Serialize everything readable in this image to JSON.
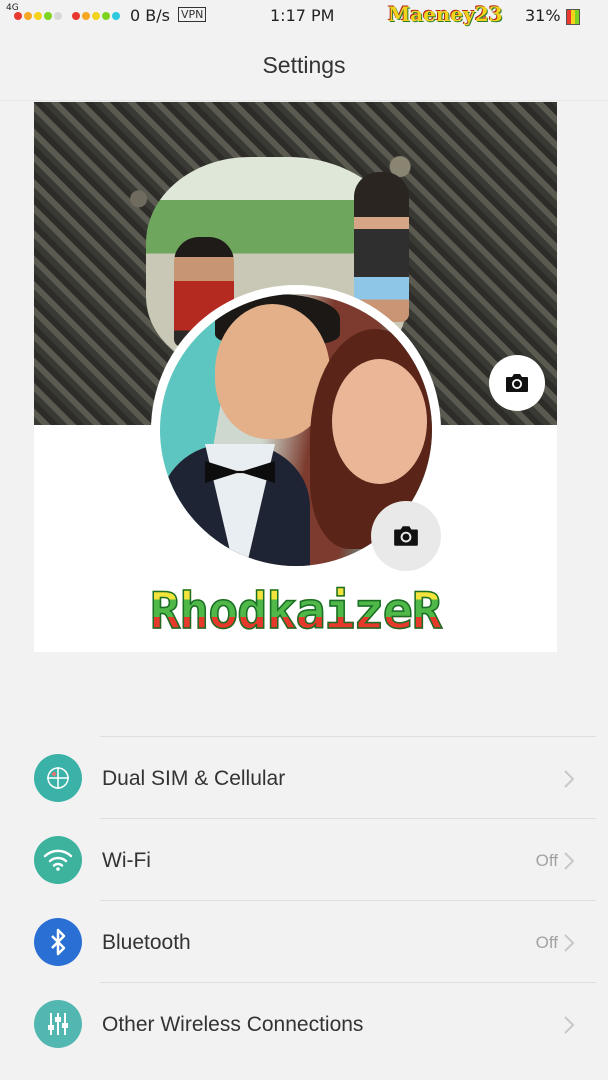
{
  "status_bar": {
    "network": "4G",
    "speed": "0 B/s",
    "vpn": "VPN",
    "time": "1:17 PM",
    "watermark": "Maeney23",
    "battery": "31%"
  },
  "nav": {
    "title": "Settings"
  },
  "profile": {
    "name": "RhodkaizeR"
  },
  "settings_items": [
    {
      "label": "Dual SIM & Cellular",
      "value": "",
      "icon": "sim-icon",
      "color": "#3bb2a8"
    },
    {
      "label": "Wi-Fi",
      "value": "Off",
      "icon": "wifi-icon",
      "color": "#3db39e"
    },
    {
      "label": "Bluetooth",
      "value": "Off",
      "icon": "bluetooth-icon",
      "color": "#2a6fd4"
    },
    {
      "label": "Other Wireless Connections",
      "value": "",
      "icon": "sliders-icon",
      "color": "#52b7b0"
    }
  ],
  "colors": {
    "background": "#f2f2f2",
    "divider": "#dedede",
    "chevron": "#c8c8c8"
  }
}
